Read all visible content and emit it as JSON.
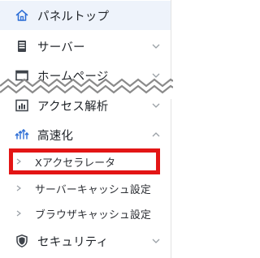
{
  "sidebar": {
    "items": [
      {
        "label": "パネルトップ",
        "icon": "home-icon",
        "selected": true,
        "arrow": "none"
      },
      {
        "label": "サーバー",
        "icon": "server-icon",
        "arrow": "down"
      },
      {
        "label": "ホームページ",
        "icon": "browser-window-icon",
        "arrow": "down"
      },
      {
        "label": "アクセス解析",
        "icon": "bar-chart-icon",
        "arrow": "down"
      },
      {
        "label": "高速化",
        "icon": "speed-arrows-icon",
        "arrow": "up",
        "expanded": true
      },
      {
        "label": "セキュリティ",
        "icon": "shield-icon",
        "arrow": "down"
      }
    ],
    "speed_subitems": [
      {
        "label": "Xアクセラレータ",
        "highlighted": true
      },
      {
        "label": "サーバーキャッシュ設定"
      },
      {
        "label": "ブラウザキャッシュ設定"
      }
    ]
  },
  "colors": {
    "accent": "#2f6fd6",
    "selected_bg": "#eef3fb",
    "highlight_border": "#e31515",
    "icon": "#4a4f57",
    "chevron": "#9aa0a6"
  }
}
